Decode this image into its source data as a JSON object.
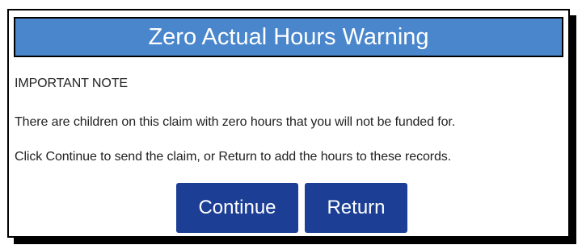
{
  "dialog": {
    "title": "Zero Actual Hours Warning",
    "note_heading": "IMPORTANT NOTE",
    "message_line_1": "There are children on this claim with zero hours that you will not be funded for.",
    "message_line_2": "Click Continue to send the claim, or Return to add the hours to these records.",
    "buttons": {
      "continue_label": "Continue",
      "return_label": "Return"
    }
  },
  "colors": {
    "title_bar_background": "#4a86cc",
    "button_background": "#1c3f95",
    "button_text": "#ffffff"
  }
}
